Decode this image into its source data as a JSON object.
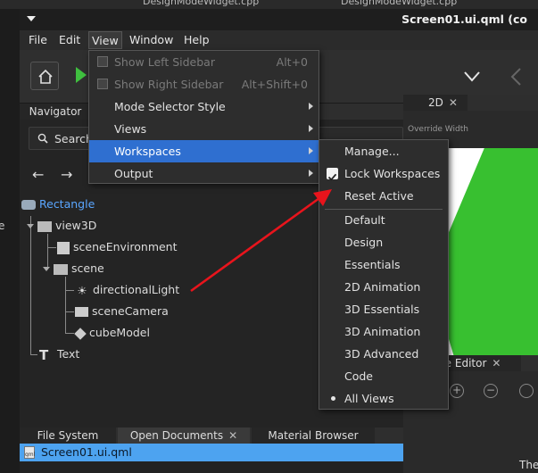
{
  "desktop": {
    "top_texts": [
      "DesignModeWidget.cpp",
      "DesignModeWidget.cpp"
    ],
    "left_text": "e"
  },
  "window": {
    "title": "Screen01.ui.qml (co"
  },
  "menubar": {
    "items": [
      "File",
      "Edit",
      "View",
      "Window",
      "Help"
    ]
  },
  "navigator": {
    "tab": "Navigator",
    "search_placeholder": "Search",
    "tree": [
      {
        "label": "Rectangle",
        "icon": "rectangle-icon",
        "selected": true
      },
      {
        "label": "view3D",
        "icon": "view3d-icon"
      },
      {
        "label": "sceneEnvironment",
        "icon": "scene-environment-icon"
      },
      {
        "label": "scene",
        "icon": "scene-icon"
      },
      {
        "label": "directionalLight",
        "icon": "light-icon"
      },
      {
        "label": "sceneCamera",
        "icon": "camera-icon"
      },
      {
        "label": "cubeModel",
        "icon": "model-icon"
      },
      {
        "label": "Text",
        "icon": "text-icon"
      }
    ]
  },
  "view2d": {
    "tab": "2D",
    "override_label": "Override Width"
  },
  "properties": {
    "tab": "re Editor",
    "bottom_text": "The"
  },
  "bottom_tabs": [
    "File System",
    "Open Documents",
    "Material Browser"
  ],
  "open_file": "Screen01.ui.qml",
  "view_menu": {
    "items": [
      {
        "label": "Show Left Sidebar",
        "shortcut": "Alt+0",
        "disabled": true
      },
      {
        "label": "Show Right Sidebar",
        "shortcut": "Alt+Shift+0",
        "disabled": true
      },
      {
        "label": "Mode Selector Style",
        "submenu": true
      },
      {
        "label": "Views",
        "submenu": true
      },
      {
        "label": "Workspaces",
        "submenu": true,
        "highlighted": true
      },
      {
        "label": "Output",
        "submenu": true
      }
    ]
  },
  "workspaces_menu": {
    "manage": "Manage...",
    "lock": "Lock Workspaces",
    "lock_checked": true,
    "reset": "Reset Active",
    "workspaces": [
      "Default",
      "Design",
      "Essentials",
      "2D Animation",
      "3D Essentials",
      "3D Animation",
      "3D Advanced",
      "Code",
      "All Views"
    ],
    "active": "All Views"
  },
  "colors": {
    "accent": "#2f6fd0",
    "selection_bar": "#4da3f0",
    "arrow": "#e8141c",
    "canvas_green": "#38c030"
  }
}
